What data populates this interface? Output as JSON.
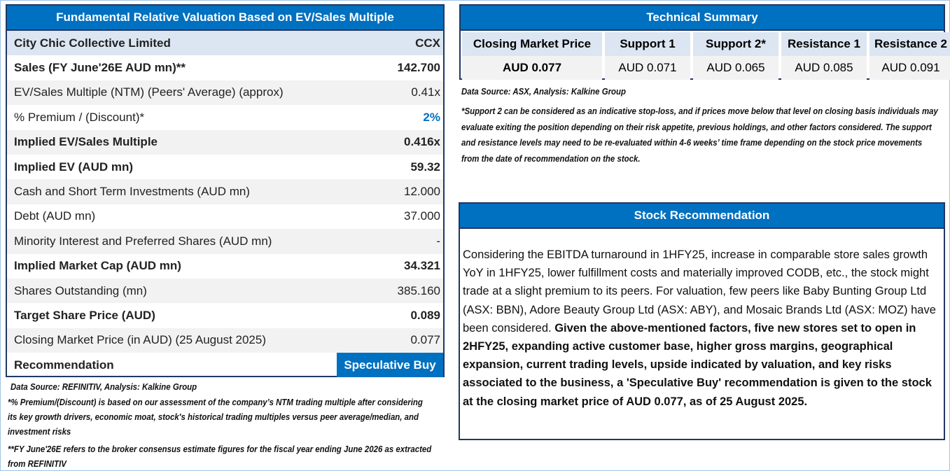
{
  "valuation": {
    "title": "Fundamental Relative Valuation Based on EV/Sales Multiple",
    "company": "City Chic Collective Limited",
    "ticker": "CCX",
    "rows": [
      {
        "label": "Sales (FY June'26E AUD mn)**",
        "value": "142.700"
      },
      {
        "label": "EV/Sales Multiple (NTM)  (Peers' Average) (approx)",
        "value": "0.41x"
      },
      {
        "label": "% Premium / (Discount)*",
        "value": "2%"
      },
      {
        "label": "Implied EV/Sales Multiple",
        "value": "0.416x"
      },
      {
        "label": "Implied EV (AUD mn)",
        "value": "59.32"
      },
      {
        "label": "Cash and Short Term Investments (AUD mn)",
        "value": "12.000"
      },
      {
        "label": "Debt (AUD mn)",
        "value": "37.000"
      },
      {
        "label": "Minority Interest and Preferred Shares (AUD mn)",
        "value": "-"
      },
      {
        "label": "Implied Market Cap (AUD mn)",
        "value": "34.321"
      },
      {
        "label": "Shares Outstanding (mn)",
        "value": "385.160"
      },
      {
        "label": "Target Share Price (AUD)",
        "value": "0.089"
      },
      {
        "label": "Closing Market Price (in AUD) (25 August 2025)",
        "value": "0.077"
      },
      {
        "label": "Recommendation",
        "value": "Speculative Buy"
      }
    ],
    "source": "Data Source: REFINITIV, Analysis: Kalkine Group",
    "note1": "*% Premium/(Discount) is based on our assessment of the company’s NTM trading multiple after considering its key growth drivers, economic moat, stock's historical trading multiples versus peer average/median, and investment risks",
    "note2": "**FY June'26E refers to the broker consensus estimate figures for the fiscal year ending June 2026 as extracted from REFINITIV"
  },
  "technical": {
    "title": "Technical Summary",
    "headers": [
      "Closing Market Price",
      "Support 1",
      "Support 2*",
      "Resistance 1",
      "Resistance 2"
    ],
    "values": [
      "AUD 0.077",
      "AUD 0.071",
      "AUD 0.065",
      "AUD 0.085",
      "AUD 0.091"
    ],
    "source": "Data Source: ASX, Analysis: Kalkine Group",
    "note": "*Support 2 can be considered as an indicative stop-loss, and if prices move below that level on closing basis individuals may evaluate exiting the position depending on their risk appetite, previous holdings, and other factors considered. The support and resistance levels may need to be re-evaluated within 4-6 weeks’ time frame depending on the stock price movements from the date of recommendation on the stock."
  },
  "recommendation": {
    "title": "Stock Recommendation",
    "text_normal": "Considering the EBITDA turnaround in 1HFY25, increase in comparable store sales growth YoY in 1HFY25, lower fulfillment costs and materially improved CODB, etc., the stock might trade at a slight premium to its peers. For valuation, few peers like Baby Bunting Group Ltd (ASX: BBN), Adore Beauty Group Ltd (ASX: ABY), and Mosaic Brands Ltd (ASX: MOZ) have been considered. ",
    "text_bold": "Given the above-mentioned factors, five new stores set to open in 2HFY25, expanding active customer base,  higher gross margins, geographical expansion, current trading levels, upside indicated by valuation, and key risks associated to the business, a 'Speculative Buy' recommendation is given to the stock at the closing market price of AUD 0.077, as of 25 August 2025."
  },
  "colors": {
    "accent": "#0070C0",
    "border": "#1F3864",
    "header_row": "#DCE6F2",
    "alt_row": "#F2F2F2"
  }
}
